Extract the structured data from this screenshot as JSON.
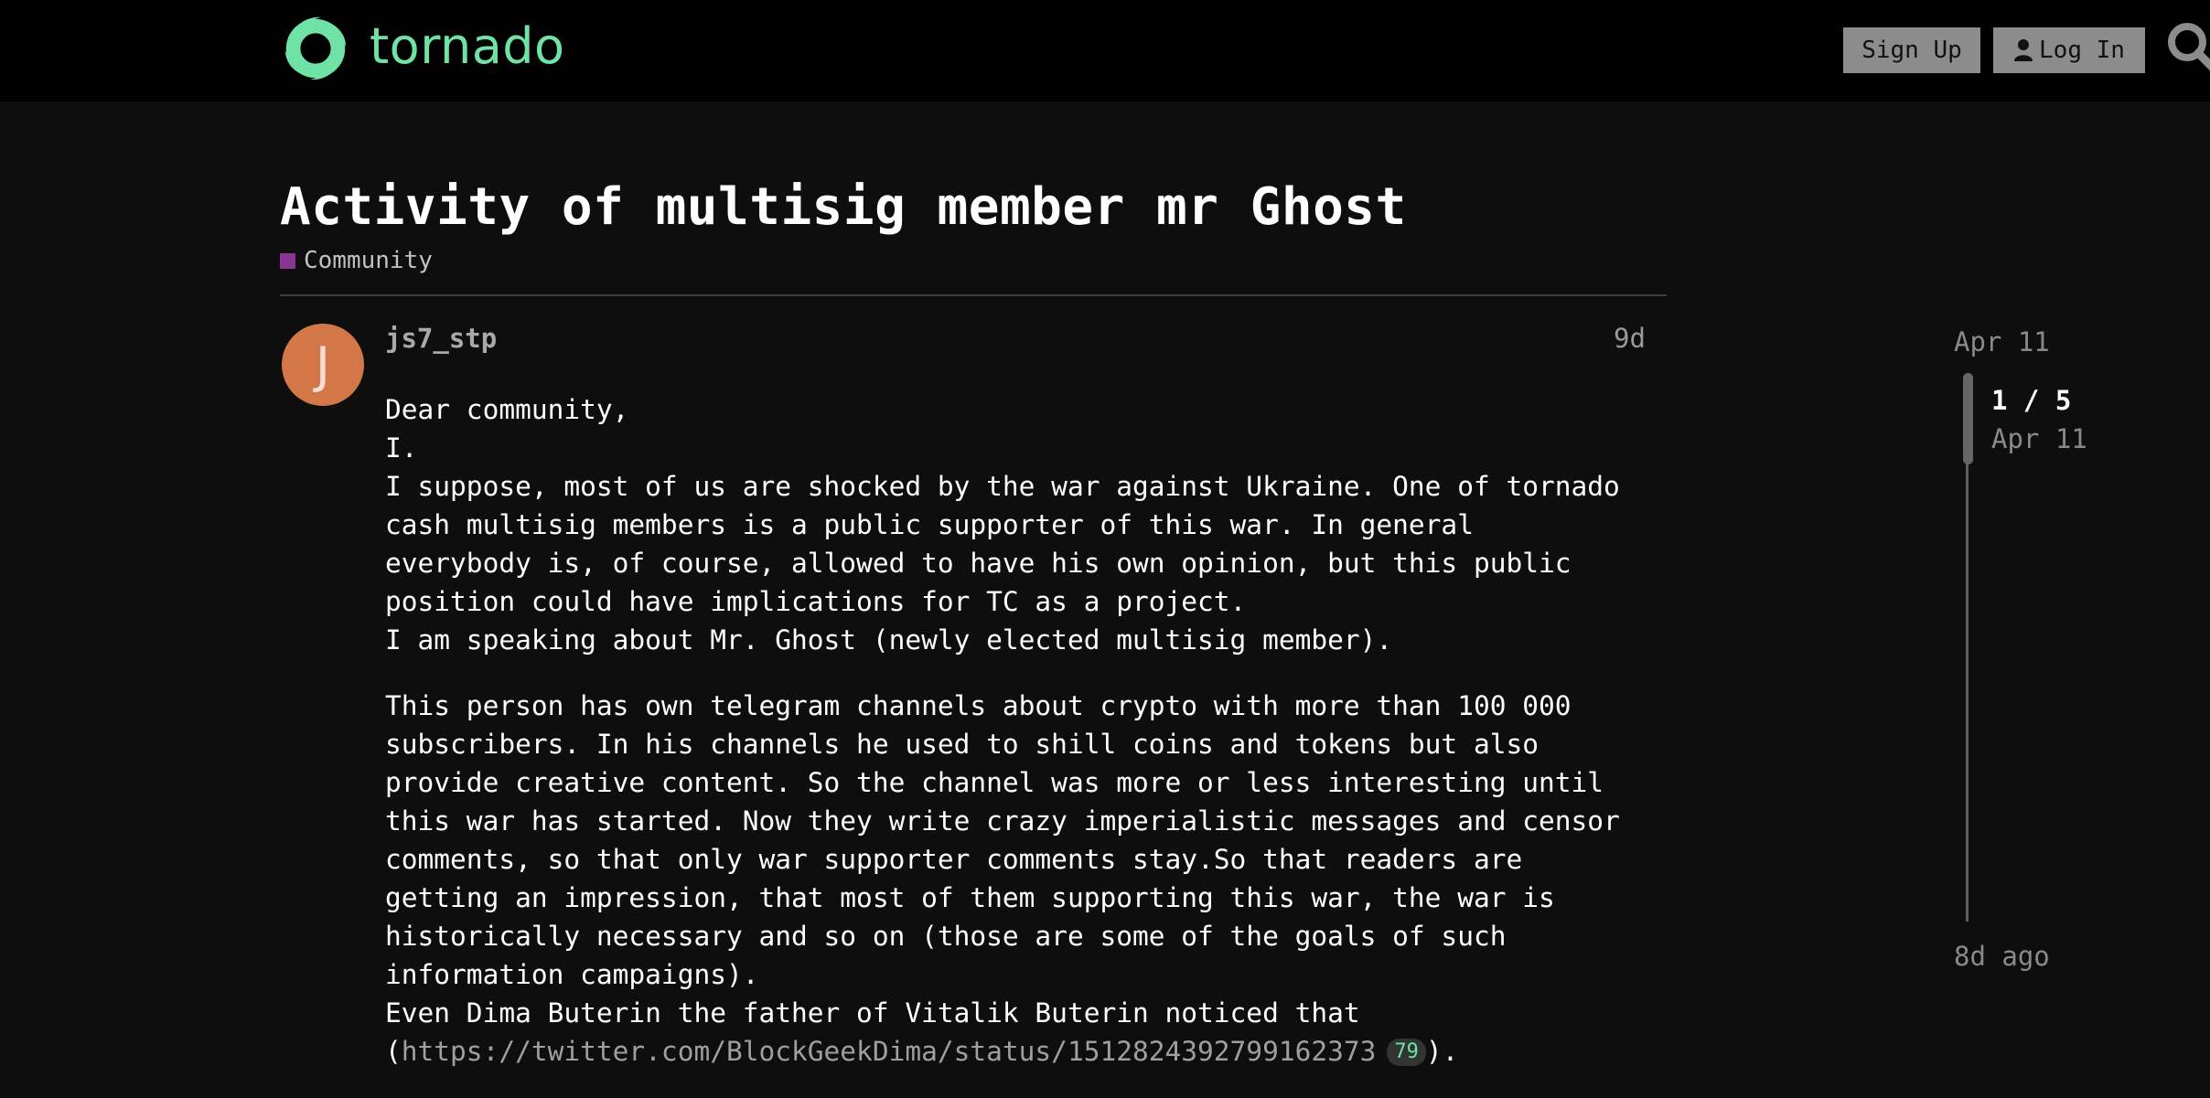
{
  "header": {
    "logo_text": "tornado",
    "logo_icon": "tornado-swirl-icon",
    "signup_label": "Sign Up",
    "login_label": "Log In",
    "login_icon": "user-icon",
    "search_icon": "search-icon"
  },
  "colors": {
    "brand": "#6fe3a6",
    "header_bg": "#000000",
    "page_bg": "#0e0e0e",
    "button_bg": "#8c8c8c",
    "category": "#8a3593",
    "avatar": "#d47748"
  },
  "topic": {
    "title": "Activity of multisig member mr Ghost",
    "category": "Community"
  },
  "post": {
    "avatar_letter": "J",
    "username": "js7_stp",
    "age": "9d",
    "paragraphs": [
      {
        "lines": [
          "Dear community,",
          "I.",
          "I suppose, most of us are shocked by the war against Ukraine. One of tornado",
          "cash multisig members is a public supporter of this war. In general",
          "everybody is, of course, allowed to have his own opinion, but this public",
          "position could have implications for TC as a project.",
          "I am speaking about Mr. Ghost (newly elected multisig member)."
        ]
      },
      {
        "lines": [
          "This person has own telegram channels about crypto with more than 100 000",
          "subscribers. In his channels he used to shill coins and tokens but also",
          "provide creative content. So the channel was more or less interesting until",
          "this war has started. Now they write crazy imperialistic messages and censor",
          "comments, so that only war supporter comments stay.So that readers are",
          "getting an impression, that most of them supporting this war, the war is",
          "historically necessary and so on (those are some of the goals of such",
          "information campaigns).",
          "Even Dima Buterin the father of Vitalik Buterin noticed that"
        ],
        "link_prefix": "(",
        "link_text": "https://twitter.com/BlockGeekDima/status/1512824392799162373",
        "link_clicks": "79",
        "link_suffix": ")."
      }
    ]
  },
  "timeline": {
    "start_date": "Apr 11",
    "position": "1 / 5",
    "position_date": "Apr 11",
    "end_label": "8d ago",
    "current_post": 1,
    "total_posts": 5
  }
}
